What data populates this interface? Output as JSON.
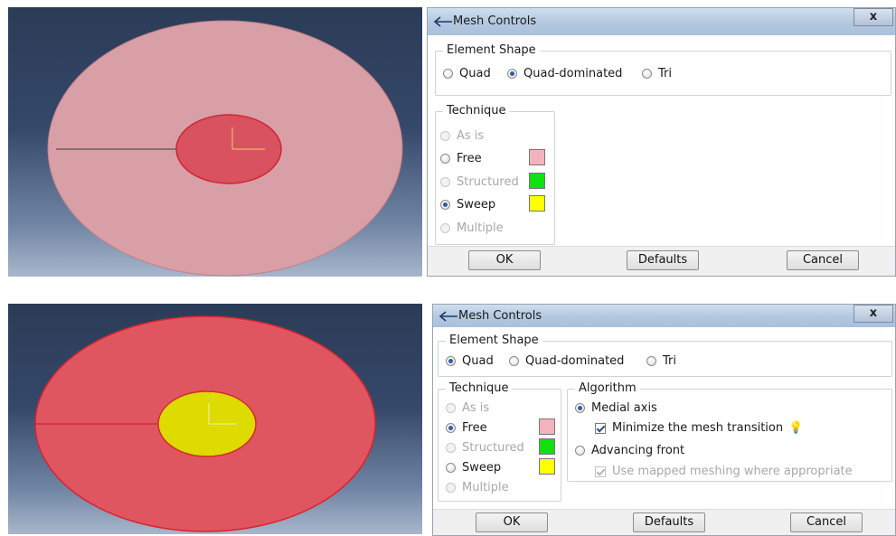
{
  "colors": {
    "pink": "#f3b3be",
    "green": "#12e012",
    "yellow": "#ffff00",
    "radio_on": "#2d5f9e"
  },
  "top": {
    "dialog": {
      "title": "Mesh Controls",
      "close": "x",
      "element_shape": {
        "title": "Element Shape",
        "options": [
          {
            "label": "Quad",
            "selected": false
          },
          {
            "label": "Quad-dominated",
            "selected": true
          },
          {
            "label": "Tri",
            "selected": false
          }
        ]
      },
      "technique": {
        "title": "Technique",
        "options": [
          {
            "label": "As is",
            "selected": false,
            "enabled": false
          },
          {
            "label": "Free",
            "selected": false,
            "enabled": true,
            "swatch": "pink"
          },
          {
            "label": "Structured",
            "selected": false,
            "enabled": false,
            "swatch": "green"
          },
          {
            "label": "Sweep",
            "selected": true,
            "enabled": true,
            "swatch": "yellow"
          },
          {
            "label": "Multiple",
            "selected": false,
            "enabled": false
          }
        ]
      },
      "buttons": {
        "ok": "OK",
        "defaults": "Defaults",
        "cancel": "Cancel"
      }
    }
  },
  "bottom": {
    "dialog": {
      "title": "Mesh Controls",
      "close": "x",
      "element_shape": {
        "title": "Element Shape",
        "options": [
          {
            "label": "Quad",
            "selected": true
          },
          {
            "label": "Quad-dominated",
            "selected": false
          },
          {
            "label": "Tri",
            "selected": false
          }
        ]
      },
      "technique": {
        "title": "Technique",
        "options": [
          {
            "label": "As is",
            "selected": false,
            "enabled": false
          },
          {
            "label": "Free",
            "selected": true,
            "enabled": true,
            "swatch": "pink"
          },
          {
            "label": "Structured",
            "selected": false,
            "enabled": false,
            "swatch": "green"
          },
          {
            "label": "Sweep",
            "selected": false,
            "enabled": true,
            "swatch": "yellow"
          },
          {
            "label": "Multiple",
            "selected": false,
            "enabled": false
          }
        ]
      },
      "algorithm": {
        "title": "Algorithm",
        "medial_axis": "Medial axis",
        "minimize": "Minimize the mesh transition",
        "advancing_front": "Advancing front",
        "use_mapped": "Use mapped meshing where appropriate"
      },
      "buttons": {
        "ok": "OK",
        "defaults": "Defaults",
        "cancel": "Cancel"
      }
    }
  }
}
